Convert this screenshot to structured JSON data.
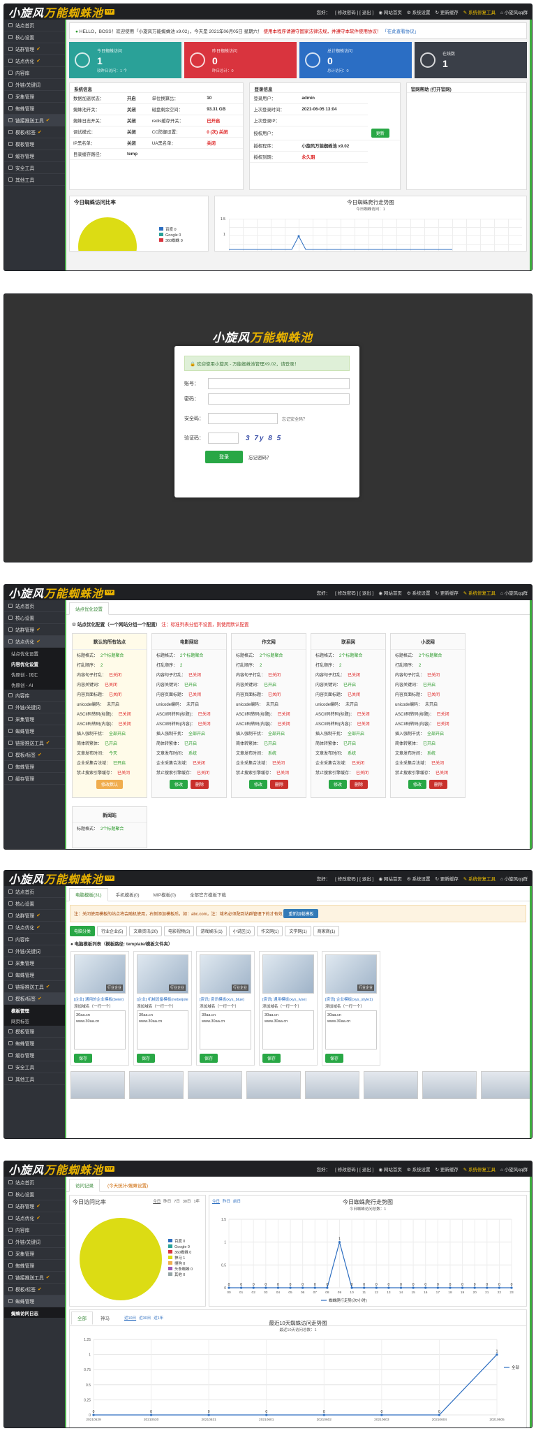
{
  "brand": {
    "name1": "小旋风",
    "name2": "万能蜘蛛池",
    "tag": "VIP"
  },
  "topnav": {
    "user": "您好：",
    "user_links": "[ 修改密码 ] [ 退出 ]",
    "home": "网站首页",
    "sys": "系统设置",
    "clear": "更新缓存",
    "repair": "系统修复工具",
    "qq": "小旋风qq群"
  },
  "menu1": [
    "站点首页",
    "核心设置",
    "站群管理",
    "站点优化",
    "内容库",
    "外链/关键词",
    "采集管理",
    "蜘蛛管理",
    "链接推送工具",
    "模板/标签",
    "模板管理",
    "缓存管理",
    "安全工具",
    "其他工具"
  ],
  "menu3": [
    "站点首页",
    "核心设置",
    "站群管理",
    "站点优化",
    "内容库",
    "外链/关键词",
    "采集管理",
    "蜘蛛管理",
    "链接推送工具",
    "模板/标签",
    "蜘蛛管理",
    "缓存管理"
  ],
  "menu3_sub": [
    "站点优化设置",
    "内容优化设置",
    "伪原创 - 词汇",
    "伪原创 - AI"
  ],
  "menu4": [
    "站点首页",
    "核心设置",
    "站群管理",
    "站点优化",
    "内容库",
    "外链/关键词",
    "采集管理",
    "蜘蛛管理",
    "链接推送工具",
    "模板/标签",
    "模板管理",
    "蜘蛛管理",
    "缓存管理",
    "安全工具",
    "其他工具"
  ],
  "menu4_sub": [
    "模板管理",
    "网页标签"
  ],
  "menu5": [
    "站点首页",
    "核心设置",
    "站群管理",
    "站点优化",
    "内容库",
    "外链/关键词",
    "采集管理",
    "蜘蛛管理",
    "链接推送工具",
    "模板/标签",
    "蜘蛛管理"
  ],
  "menu5_sub": [
    "蜘蛛访问日志"
  ],
  "dash": {
    "notice_hello": "HELLO，BOSS！欢迎使用「小旋风万能蜘蛛池 x9.02」，今天是 2021年06月05日 星期六！",
    "notice_warn": "使用本程序请遵守国家法律法规，并遵守本软件使用协议！",
    "notice_link": "「在此查看协议」",
    "cards": [
      {
        "t": "今日蜘蛛访问",
        "v": "1",
        "s": "较昨日访问：1 个",
        "color": "#2aa198"
      },
      {
        "t": "昨日蜘蛛访问",
        "v": "0",
        "s": "昨日总计：0",
        "color": "#d9343e"
      },
      {
        "t": "总计蜘蛛访问",
        "v": "0",
        "s": "总计访问：0",
        "color": "#2b6ec4"
      },
      {
        "t": "在线数",
        "v": "1",
        "s": "",
        "color": "#3a3f48"
      }
    ],
    "sys_title": "系统信息",
    "sys_rows": [
      [
        "数据加速状态：",
        "开启",
        "单位换算比：",
        "10"
      ],
      [
        "蜘蛛池开关：",
        "关闭",
        "磁盘剩余空间：",
        "93.31 GB"
      ],
      [
        "蜘蛛日志开关：",
        "关闭",
        "redis缓存开关：",
        "已开启"
      ],
      [
        "调试模式：",
        "关闭",
        "CC防御设置：",
        "0 (次) 关闭"
      ],
      [
        "IP黑名单：",
        "关闭",
        "UA黑名单：",
        "关闭"
      ],
      [
        "目录缓存路径：",
        "temp",
        "",
        " "
      ]
    ],
    "acc_title": "登录信息",
    "acc_rows": [
      [
        "登录用户：",
        "admin"
      ],
      [
        "上次登录时间：",
        "2021-06-05 13:04"
      ],
      [
        "上次登录IP：",
        ""
      ],
      [
        "授权用户：",
        ""
      ],
      [
        "授权程序：",
        "小旋风万能蜘蛛池 x9.02"
      ],
      [
        "授权到期：",
        "永久期"
      ]
    ],
    "acc_btn": "更新",
    "faq_title": "官网帮助 (打开官网)",
    "pie_title": "今日蜘蛛访问比率",
    "pie_legend": [
      "百度 0",
      "Google 0",
      "360蜘蛛 0"
    ],
    "trend_title": "今日蜘蛛爬行走势图",
    "trend_sub": "今日蜘蛛访问：1"
  },
  "login": {
    "msg": "欢迎使用小旋风 - 万能蜘蛛池管理X9.02，请登录！",
    "user_label": "账号：",
    "pass_label": "密码：",
    "safe_label": "安全码：",
    "safe_hint": "忘记安全码？",
    "code_label": "验证码：",
    "code": "3 7y 8 5",
    "login_btn": "登录",
    "forgot": "忘记密码？"
  },
  "opt": {
    "tab": "站点优化设置",
    "head": "站点优化配置（一个网站分组一个配置）",
    "head_note": "注：标准列表分组不设置，则使用默认配置",
    "cards": [
      {
        "name": "默认的所有站点",
        "rows": [
          [
            "标题格式：",
            "2个标题聚合"
          ],
          [
            "打乱顺序：",
            "2"
          ],
          [
            "内容句子打乱：",
            "已关闭"
          ],
          [
            "内容关键词：",
            "已关闭"
          ],
          [
            "内容页面标题：",
            "已关闭"
          ],
          [
            "unicode编码：",
            "未开启"
          ],
          [
            "ASCII码转码(标题)：",
            "已关闭"
          ],
          [
            "ASCII码转码(内容)：",
            "已关闭"
          ],
          [
            "插入强制干扰：",
            "全部开启"
          ],
          [
            "简体转繁体：",
            "已开启"
          ],
          [
            "文章发布时间：",
            "今天"
          ],
          [
            "企业采集合法域：",
            "已开启"
          ],
          [
            "禁止搜索引擎缓存：",
            "已关闭"
          ]
        ],
        "acts": [
          "修改默认"
        ]
      },
      {
        "name": "电影网站",
        "rows": [
          [
            "标题格式：",
            "2个标题聚合"
          ],
          [
            "打乱顺序：",
            "2"
          ],
          [
            "内容句子打乱：",
            "已关闭"
          ],
          [
            "内容关键词：",
            "已开启"
          ],
          [
            "内容页面标题：",
            "已关闭"
          ],
          [
            "unicode编码：",
            "未开启"
          ],
          [
            "ASCII码转码(标题)：",
            "已关闭"
          ],
          [
            "ASCII码转码(内容)：",
            "已关闭"
          ],
          [
            "插入强制干扰：",
            "全部开启"
          ],
          [
            "简体转繁体：",
            "已开启"
          ],
          [
            "文章发布时间：",
            "系统"
          ],
          [
            "企业采集合法域：",
            "已关闭"
          ],
          [
            "禁止搜索引擎缓存：",
            "已关闭"
          ]
        ],
        "acts": [
          "修改",
          "删除"
        ]
      },
      {
        "name": "作文网",
        "rows": [
          [
            "标题格式：",
            "2个标题聚合"
          ],
          [
            "打乱顺序：",
            "2"
          ],
          [
            "内容句子打乱：",
            "已关闭"
          ],
          [
            "内容关键词：",
            "已开启"
          ],
          [
            "内容页面标题：",
            "已关闭"
          ],
          [
            "unicode编码：",
            "未开启"
          ],
          [
            "ASCII码转码(标题)：",
            "已关闭"
          ],
          [
            "ASCII码转码(内容)：",
            "已关闭"
          ],
          [
            "插入强制干扰：",
            "全部开启"
          ],
          [
            "简体转繁体：",
            "已开启"
          ],
          [
            "文章发布时间：",
            "系统"
          ],
          [
            "企业采集合法域：",
            "已关闭"
          ],
          [
            "禁止搜索引擎缓存：",
            "已关闭"
          ]
        ],
        "acts": [
          "修改",
          "删除"
        ]
      },
      {
        "name": "联系网",
        "rows": [
          [
            "标题格式：",
            "2个标题聚合"
          ],
          [
            "打乱顺序：",
            "2"
          ],
          [
            "内容句子打乱：",
            "已关闭"
          ],
          [
            "内容关键词：",
            "已开启"
          ],
          [
            "内容页面标题：",
            "已关闭"
          ],
          [
            "unicode编码：",
            "未开启"
          ],
          [
            "ASCII码转码(标题)：",
            "已关闭"
          ],
          [
            "ASCII码转码(内容)：",
            "已关闭"
          ],
          [
            "插入强制干扰：",
            "全部开启"
          ],
          [
            "简体转繁体：",
            "已开启"
          ],
          [
            "文章发布时间：",
            "系统"
          ],
          [
            "企业采集合法域：",
            "已关闭"
          ],
          [
            "禁止搜索引擎缓存：",
            "已关闭"
          ]
        ],
        "acts": [
          "修改",
          "删除"
        ]
      },
      {
        "name": "小说网",
        "rows": [
          [
            "标题格式：",
            "2个标题聚合"
          ],
          [
            "打乱顺序：",
            "2"
          ],
          [
            "内容句子打乱：",
            "已关闭"
          ],
          [
            "内容关键词：",
            "已开启"
          ],
          [
            "内容页面标题：",
            "已关闭"
          ],
          [
            "unicode编码：",
            "未开启"
          ],
          [
            "ASCII码转码(标题)：",
            "已关闭"
          ],
          [
            "ASCII码转码(内容)：",
            "已关闭"
          ],
          [
            "插入强制干扰：",
            "全部开启"
          ],
          [
            "简体转繁体：",
            "已开启"
          ],
          [
            "文章发布时间：",
            "系统"
          ],
          [
            "企业采集合法域：",
            "已关闭"
          ],
          [
            "禁止搜索引擎缓存：",
            "已关闭"
          ]
        ],
        "acts": [
          "修改",
          "删除"
        ]
      }
    ],
    "card6_name": "新闻站",
    "card6_row": [
      "标题格式：",
      "2个标题聚合"
    ]
  },
  "tpl": {
    "tabs": [
      "电脑模板(31)",
      "手机模板(0)",
      "MIP模板(0)",
      "全部官方模板下载"
    ],
    "note": "注：关闭使用模板的站点将会随机使用，右侧添加模板后，如：abc.com，注：域名必须配到站群管理下的才有效",
    "note_btn": "重新加载模板",
    "filters": [
      "电脑分类",
      "行业企业(5)",
      "文章资讯(20)",
      "电影视频(3)",
      "游戏娱乐(1)",
      "小说区(1)",
      "作文网(1)",
      "文学网(1)",
      "商家商(1)"
    ],
    "list_title": "电脑模板列表（模板路径: template/模板文件夹）",
    "items": [
      {
        "name": "[企业] 通用的企业模板(beier)",
        "tag": "行业企业",
        "label": "添加域名（一行一个）",
        "domains": "30aa.cn\nwww.30aa.cn",
        "btn": "保存"
      },
      {
        "name": "[企业] 机械设备模板(nebeijole)",
        "tag": "行业企业",
        "label": "添加域名（一行一个）",
        "domains": "30aa.cn\nwww.30aa.cn",
        "btn": "保存"
      },
      {
        "name": "[资讯] 资讯模板(xys_blue)",
        "tag": "行业企业",
        "label": "添加域名（一行一个）",
        "domains": "30aa.cn\nwww.30aa.cn",
        "btn": "保存"
      },
      {
        "name": "[资讯] 通用模板(xys_lvse)",
        "tag": "",
        "label": "添加域名（一行一个）",
        "domains": "30aa.cn\nwww.30aa.cn",
        "btn": "保存"
      },
      {
        "name": "[资讯] 企业模板(xys_style1)",
        "tag": "行业企业",
        "label": "添加域名（一行一个）",
        "domains": "30aa.cn\nwww.30aa.cn",
        "btn": "保存"
      }
    ]
  },
  "stats": {
    "tabs": [
      "访问记录",
      "(今天统计/蜘蛛设置)"
    ],
    "pie_title": "今日访问比率",
    "pie_range": [
      "今日",
      "昨日",
      "7日",
      "30日",
      "1年"
    ],
    "legend": [
      "百度 0",
      "Google 0",
      "360蜘蛛 0",
      "神马 1",
      "搜狗 0",
      "头条蜘蛛 0",
      "其他 0"
    ],
    "trend_range": [
      "今日",
      "昨日",
      "前日"
    ],
    "trend_title": "今日蜘蛛爬行走势图",
    "trend_sub": "今日蜘蛛访问总数：1",
    "trend_legend": "蜘蛛爬行走势(次/小时)",
    "low_tabs": [
      "全部",
      "神马"
    ],
    "low_range": [
      "近10日",
      "近30日",
      "近1年"
    ],
    "low_title": "最近10天蜘蛛访问走势图",
    "low_sub": "最近10天访问总数：1",
    "low_legend": "全部"
  },
  "chart_data": [
    {
      "type": "line",
      "title": "今日蜘蛛爬行走势图",
      "x": [
        "00",
        "01",
        "02",
        "03",
        "04",
        "05",
        "06",
        "07",
        "08",
        "09",
        "10",
        "11",
        "12",
        "13",
        "14",
        "15",
        "16",
        "17",
        "18",
        "19",
        "20",
        "21",
        "22",
        "23"
      ],
      "series": [
        {
          "name": "蜘蛛爬行走势(次/小时)",
          "values": [
            0,
            0,
            0,
            0,
            0,
            0,
            0,
            0,
            0,
            1,
            0,
            0,
            0,
            0,
            0,
            0,
            0,
            0,
            0,
            0,
            0,
            0,
            0,
            0
          ]
        }
      ],
      "ylim": [
        0,
        1.5
      ]
    },
    {
      "type": "line",
      "title": "最近10天蜘蛛访问走势图",
      "x": [
        "20210529",
        "20210530",
        "20210531",
        "20210601",
        "20210602",
        "20210603",
        "20210604",
        "20210605"
      ],
      "series": [
        {
          "name": "全部",
          "values": [
            0,
            0,
            0,
            0,
            0,
            0,
            0,
            1
          ]
        }
      ],
      "ylim": [
        0,
        1.25
      ]
    }
  ]
}
